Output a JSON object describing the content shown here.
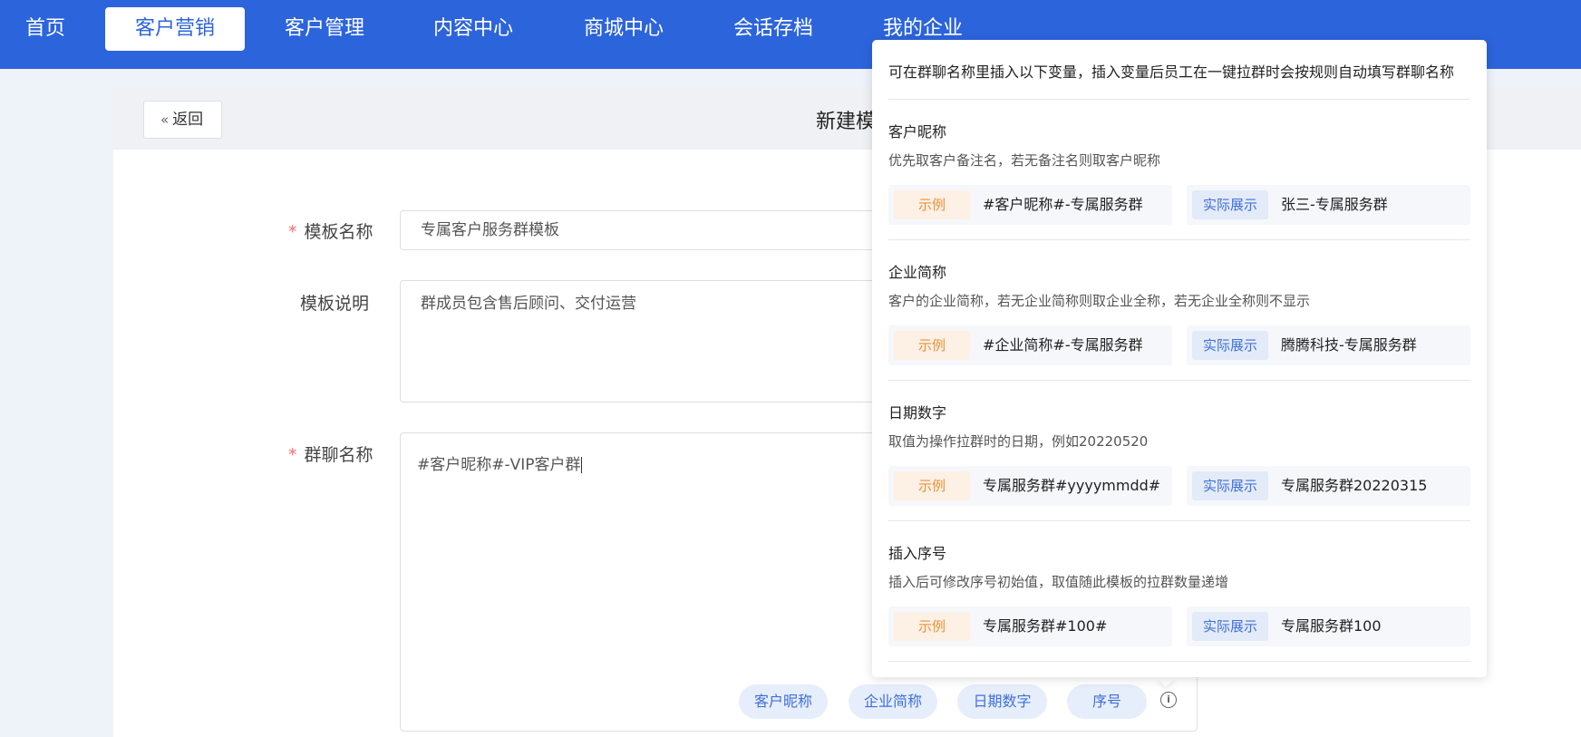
{
  "nav": {
    "items": [
      {
        "label": "首页"
      },
      {
        "label": "客户营销",
        "active": true
      },
      {
        "label": "客户管理"
      },
      {
        "label": "内容中心"
      },
      {
        "label": "商城中心"
      },
      {
        "label": "会话存档"
      },
      {
        "label": "我的企业"
      }
    ]
  },
  "header": {
    "back_label": "返回",
    "back_icon": "double-chevron-left-icon",
    "title": "新建模"
  },
  "form": {
    "template_name": {
      "label": "模板名称",
      "required": true,
      "value": "专属客户服务群模板"
    },
    "template_desc": {
      "label": "模板说明",
      "required": false,
      "value": "群成员包含售后顾问、交付运营"
    },
    "group_name": {
      "label": "群聊名称",
      "required": true,
      "value": "#客户昵称#-VIP客户群",
      "variables": [
        "客户昵称",
        "企业简称",
        "日期数字",
        "序号"
      ],
      "info_icon": "info-circle-icon"
    }
  },
  "popover": {
    "intro": "可在群聊名称里插入以下变量，插入变量后员工在一键拉群时会按规则自动填写群聊名称",
    "example_tag": "示例",
    "display_tag": "实际展示",
    "sections": [
      {
        "title": "客户昵称",
        "desc": "优先取客户备注名，若无备注名则取客户昵称",
        "example": "#客户昵称#-专属服务群",
        "display": "张三-专属服务群"
      },
      {
        "title": "企业简称",
        "desc": "客户的企业简称，若无企业简称则取企业全称，若无企业全称则不显示",
        "example": "#企业简称#-专属服务群",
        "display": "腾腾科技-专属服务群"
      },
      {
        "title": "日期数字",
        "desc": "取值为操作拉群时的日期，例如20220520",
        "example": "专属服务群#yyyymmdd#",
        "display": "专属服务群20220315"
      },
      {
        "title": "插入序号",
        "desc": "插入后可修改序号初始值，取值随此模板的拉群数量递增",
        "example": "专属服务群#100#",
        "display": "专属服务群100"
      }
    ]
  },
  "colors": {
    "primary": "#2c64dc",
    "required": "#f56c6c",
    "example_tag_text": "#e8923a",
    "display_tag_text": "#3f6fd8"
  }
}
